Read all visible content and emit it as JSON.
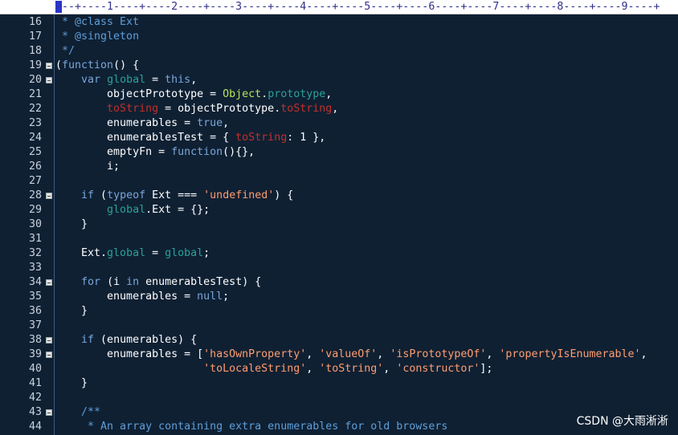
{
  "ruler": {
    "text": "---+----1----+----2----+----3----+----4----+----5----+----6----+----7----+----8----+----9----+"
  },
  "lines": [
    {
      "num": "16",
      "fold": false,
      "tokens": [
        {
          "t": " * @class Ext",
          "c": "c"
        }
      ]
    },
    {
      "num": "17",
      "fold": false,
      "tokens": [
        {
          "t": " * @singleton",
          "c": "c"
        }
      ]
    },
    {
      "num": "18",
      "fold": false,
      "tokens": [
        {
          "t": " */",
          "c": "c"
        }
      ]
    },
    {
      "num": "19",
      "fold": true,
      "tokens": [
        {
          "t": "(",
          "c": "p"
        },
        {
          "t": "function",
          "c": "k"
        },
        {
          "t": "() {",
          "c": "p"
        }
      ]
    },
    {
      "num": "20",
      "fold": true,
      "tokens": [
        {
          "t": "    ",
          "c": "p"
        },
        {
          "t": "var",
          "c": "k"
        },
        {
          "t": " ",
          "c": "p"
        },
        {
          "t": "global",
          "c": "g"
        },
        {
          "t": " = ",
          "c": "p"
        },
        {
          "t": "this",
          "c": "k"
        },
        {
          "t": ",",
          "c": "p"
        }
      ]
    },
    {
      "num": "21",
      "fold": false,
      "tokens": [
        {
          "t": "        objectPrototype = ",
          "c": "p"
        },
        {
          "t": "Object",
          "c": "o"
        },
        {
          "t": ".",
          "c": "p"
        },
        {
          "t": "prototype",
          "c": "g"
        },
        {
          "t": ",",
          "c": "p"
        }
      ]
    },
    {
      "num": "22",
      "fold": false,
      "tokens": [
        {
          "t": "        ",
          "c": "p"
        },
        {
          "t": "toString",
          "c": "r"
        },
        {
          "t": " = objectPrototype.",
          "c": "p"
        },
        {
          "t": "toString",
          "c": "r"
        },
        {
          "t": ",",
          "c": "p"
        }
      ]
    },
    {
      "num": "23",
      "fold": false,
      "tokens": [
        {
          "t": "        enumerables = ",
          "c": "p"
        },
        {
          "t": "true",
          "c": "k"
        },
        {
          "t": ",",
          "c": "p"
        }
      ]
    },
    {
      "num": "24",
      "fold": false,
      "tokens": [
        {
          "t": "        enumerablesTest = { ",
          "c": "p"
        },
        {
          "t": "toString",
          "c": "r"
        },
        {
          "t": ": 1 },",
          "c": "p"
        }
      ]
    },
    {
      "num": "25",
      "fold": false,
      "tokens": [
        {
          "t": "        emptyFn = ",
          "c": "p"
        },
        {
          "t": "function",
          "c": "k"
        },
        {
          "t": "(){},",
          "c": "p"
        }
      ]
    },
    {
      "num": "26",
      "fold": false,
      "tokens": [
        {
          "t": "        i;",
          "c": "p"
        }
      ]
    },
    {
      "num": "27",
      "fold": false,
      "tokens": []
    },
    {
      "num": "28",
      "fold": true,
      "tokens": [
        {
          "t": "    ",
          "c": "p"
        },
        {
          "t": "if",
          "c": "k"
        },
        {
          "t": " (",
          "c": "p"
        },
        {
          "t": "typeof",
          "c": "k"
        },
        {
          "t": " Ext === ",
          "c": "p"
        },
        {
          "t": "'undefined'",
          "c": "s"
        },
        {
          "t": ") {",
          "c": "p"
        }
      ]
    },
    {
      "num": "29",
      "fold": false,
      "tokens": [
        {
          "t": "        ",
          "c": "p"
        },
        {
          "t": "global",
          "c": "g"
        },
        {
          "t": ".Ext = {};",
          "c": "p"
        }
      ]
    },
    {
      "num": "30",
      "fold": false,
      "tokens": [
        {
          "t": "    }",
          "c": "p"
        }
      ]
    },
    {
      "num": "31",
      "fold": false,
      "tokens": []
    },
    {
      "num": "32",
      "fold": false,
      "tokens": [
        {
          "t": "    Ext.",
          "c": "p"
        },
        {
          "t": "global",
          "c": "g"
        },
        {
          "t": " = ",
          "c": "p"
        },
        {
          "t": "global",
          "c": "g"
        },
        {
          "t": ";",
          "c": "p"
        }
      ]
    },
    {
      "num": "33",
      "fold": false,
      "tokens": []
    },
    {
      "num": "34",
      "fold": true,
      "tokens": [
        {
          "t": "    ",
          "c": "p"
        },
        {
          "t": "for",
          "c": "k"
        },
        {
          "t": " (i ",
          "c": "p"
        },
        {
          "t": "in",
          "c": "k"
        },
        {
          "t": " enumerablesTest) {",
          "c": "p"
        }
      ]
    },
    {
      "num": "35",
      "fold": false,
      "tokens": [
        {
          "t": "        enumerables = ",
          "c": "p"
        },
        {
          "t": "null",
          "c": "k"
        },
        {
          "t": ";",
          "c": "p"
        }
      ]
    },
    {
      "num": "36",
      "fold": false,
      "tokens": [
        {
          "t": "    }",
          "c": "p"
        }
      ]
    },
    {
      "num": "37",
      "fold": false,
      "tokens": []
    },
    {
      "num": "38",
      "fold": true,
      "tokens": [
        {
          "t": "    ",
          "c": "p"
        },
        {
          "t": "if",
          "c": "k"
        },
        {
          "t": " (enumerables) {",
          "c": "p"
        }
      ]
    },
    {
      "num": "39",
      "fold": true,
      "tokens": [
        {
          "t": "        enumerables = [",
          "c": "p"
        },
        {
          "t": "'hasOwnProperty'",
          "c": "s"
        },
        {
          "t": ", ",
          "c": "p"
        },
        {
          "t": "'valueOf'",
          "c": "s"
        },
        {
          "t": ", ",
          "c": "p"
        },
        {
          "t": "'isPrototypeOf'",
          "c": "s"
        },
        {
          "t": ", ",
          "c": "p"
        },
        {
          "t": "'propertyIsEnumerable'",
          "c": "s"
        },
        {
          "t": ",",
          "c": "p"
        }
      ]
    },
    {
      "num": "40",
      "fold": false,
      "tokens": [
        {
          "t": "                       ",
          "c": "p"
        },
        {
          "t": "'toLocaleString'",
          "c": "s"
        },
        {
          "t": ", ",
          "c": "p"
        },
        {
          "t": "'toString'",
          "c": "s"
        },
        {
          "t": ", ",
          "c": "p"
        },
        {
          "t": "'constructor'",
          "c": "s"
        },
        {
          "t": "];",
          "c": "p"
        }
      ]
    },
    {
      "num": "41",
      "fold": false,
      "tokens": [
        {
          "t": "    }",
          "c": "p"
        }
      ]
    },
    {
      "num": "42",
      "fold": false,
      "tokens": []
    },
    {
      "num": "43",
      "fold": true,
      "tokens": [
        {
          "t": "    /**",
          "c": "c"
        }
      ]
    },
    {
      "num": "44",
      "fold": false,
      "tokens": [
        {
          "t": "     * An array containing extra enumerables for old browsers",
          "c": "c"
        }
      ]
    }
  ],
  "watermark": "CSDN @大雨淅淅"
}
